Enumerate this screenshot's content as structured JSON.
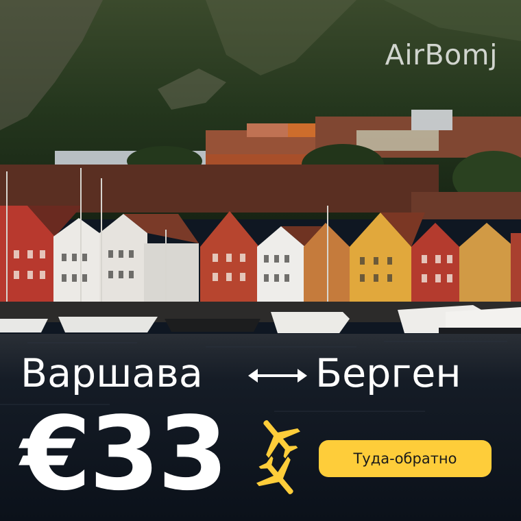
{
  "brand": {
    "logo_text": "AirBomj"
  },
  "route": {
    "from": "Варшава",
    "to": "Берген",
    "arrow_icon": "double-arrow-icon"
  },
  "offer": {
    "price": "€33",
    "trip_type": "Туда-обратно",
    "plane_icon": "airplane-icon"
  },
  "colors": {
    "accent": "#fecd3a",
    "text": "#ffffff",
    "water": "#101820"
  }
}
